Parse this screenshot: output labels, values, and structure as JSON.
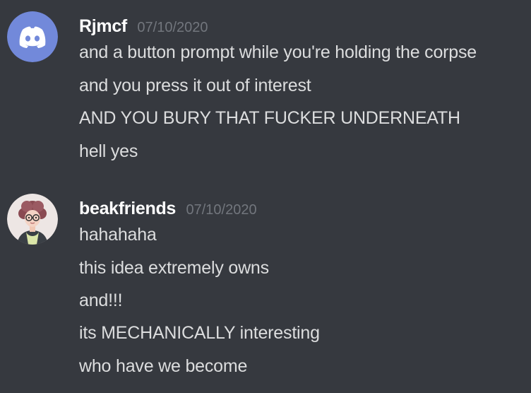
{
  "messages": [
    {
      "author": "Rjmcf",
      "timestamp": "07/10/2020",
      "avatar_icon": "discord-default-avatar-icon",
      "avatar_color": "#7289da",
      "lines": [
        "and a button prompt while you're holding the corpse",
        "and you press it out of interest",
        "AND YOU BURY THAT FUCKER UNDERNEATH",
        "hell yes"
      ]
    },
    {
      "author": "beakfriends",
      "timestamp": "07/10/2020",
      "avatar_icon": "user-portrait-avatar-icon",
      "lines": [
        "hahahaha",
        "this idea extremely owns",
        "and!!!",
        "its MECHANICALLY interesting",
        "who have we become"
      ]
    }
  ]
}
